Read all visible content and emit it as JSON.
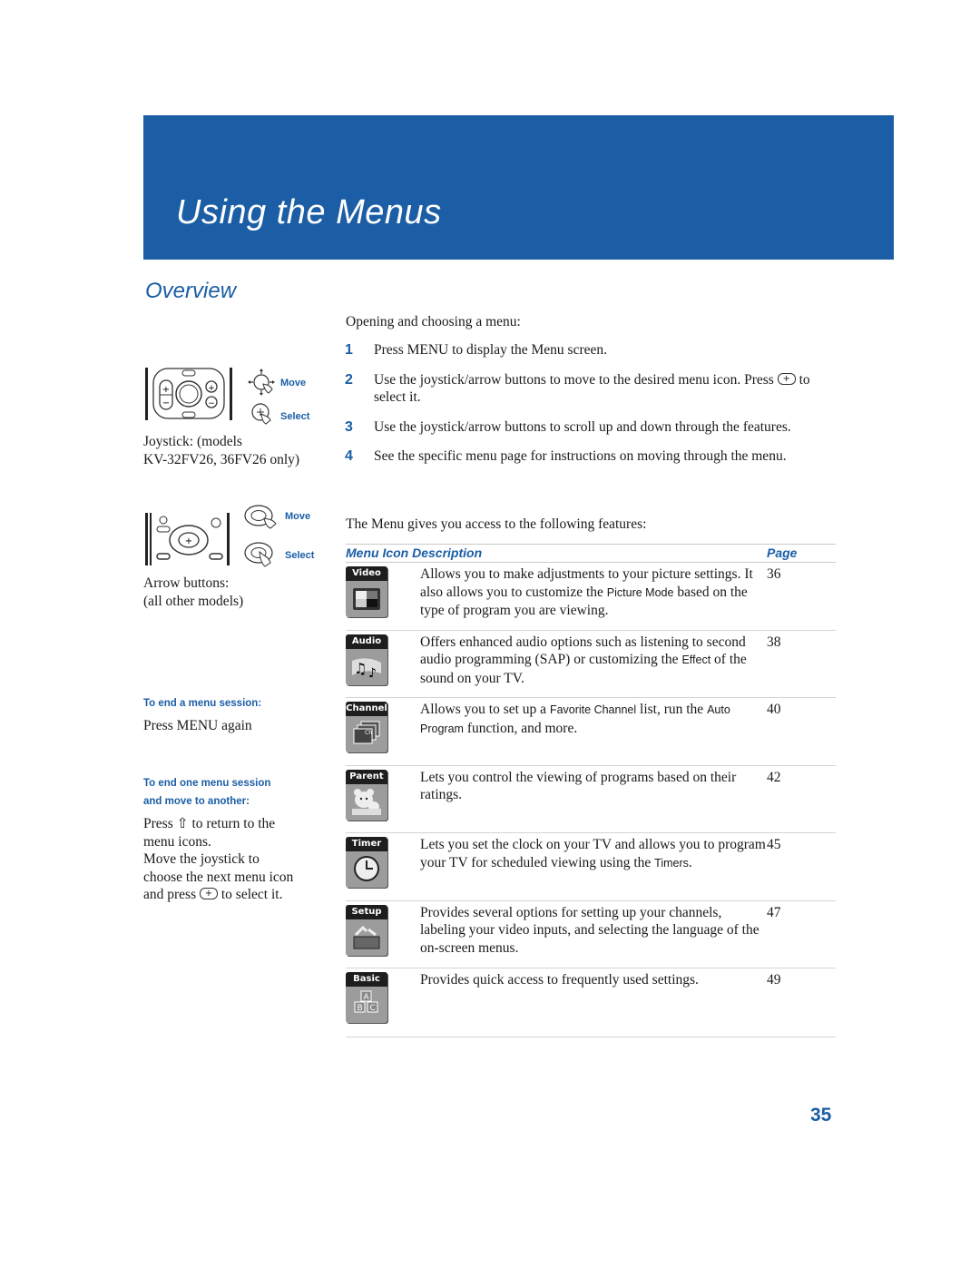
{
  "header": {
    "title": "Using the Menus"
  },
  "section": {
    "title": "Overview"
  },
  "left": {
    "joystick": {
      "move_label": "Move",
      "select_label": "Select",
      "caption_line1": "Joystick: (models",
      "caption_line2": "KV-32FV26, 36FV26 only)"
    },
    "arrows": {
      "move_label": "Move",
      "select_label": "Select",
      "caption_line1": "Arrow buttons:",
      "caption_line2": "(all other models)"
    },
    "end_session": {
      "heading": "To end a menu session:",
      "text": "Press MENU again"
    },
    "move_another": {
      "heading_line1": "To end one menu session",
      "heading_line2": "and move to another:",
      "line1": "Press ⇧ to return to the",
      "line2": "menu icons.",
      "line3": "Move the joystick to",
      "line4": "choose the next menu icon",
      "line5_a": "and press",
      "line5_b": "to select it."
    }
  },
  "main": {
    "intro": "Opening and choosing a menu:",
    "steps": [
      {
        "num": "1",
        "text": "Press MENU to display the Menu screen."
      },
      {
        "num": "2",
        "text_a": "Use the joystick/arrow buttons to move to the desired menu icon. Press",
        "text_b": "to select it."
      },
      {
        "num": "3",
        "text": "Use the joystick/arrow buttons to scroll up and down through the features."
      },
      {
        "num": "4",
        "text": "See the specific menu page for instructions on moving through the menu."
      }
    ],
    "access": "The Menu gives you access to the following features:",
    "table": {
      "headers": {
        "icon_desc": "Menu Icon Description",
        "page": "Page"
      },
      "rows": [
        {
          "icon": "video-icon",
          "label": "Video",
          "desc_a": "Allows you to make adjustments to your picture settings. It also allows you to customize the ",
          "desc_sans": "Picture Mode",
          "desc_b": " based on the type of program you are viewing.",
          "page": "36"
        },
        {
          "icon": "audio-icon",
          "label": "Audio",
          "desc_a": "Offers enhanced audio options such as listening to second audio programming (SAP) or customizing the ",
          "desc_sans": "Effect",
          "desc_b": " of the sound on your TV.",
          "page": "38"
        },
        {
          "icon": "channel-icon",
          "label": "Channel",
          "desc_a": "Allows you to set up a ",
          "desc_sans": "Favorite Channel",
          "desc_b": " list, run the ",
          "desc_sans2": "Auto Program",
          "desc_c": " function, and more.",
          "page": "40"
        },
        {
          "icon": "parent-icon",
          "label": "Parent",
          "desc_a": "Lets you control the viewing of programs based on their ratings.",
          "page": "42"
        },
        {
          "icon": "timer-icon",
          "label": "Timer",
          "desc_a": "Lets you set the clock on your TV and allows you to program your TV for scheduled viewing using the ",
          "desc_sans": "Timers",
          "desc_b": ".",
          "page": "45"
        },
        {
          "icon": "setup-icon",
          "label": "Setup",
          "desc_a": "Provides several options for  setting up your channels, labeling your video inputs, and selecting the language of the on-screen menus.",
          "page": "47"
        },
        {
          "icon": "basic-icon",
          "label": "Basic",
          "desc_a": "Provides quick access to frequently used settings.",
          "page": "49"
        }
      ]
    }
  },
  "footer": {
    "page_number": "35"
  },
  "colors": {
    "brand_blue": "#1b5ea6"
  }
}
